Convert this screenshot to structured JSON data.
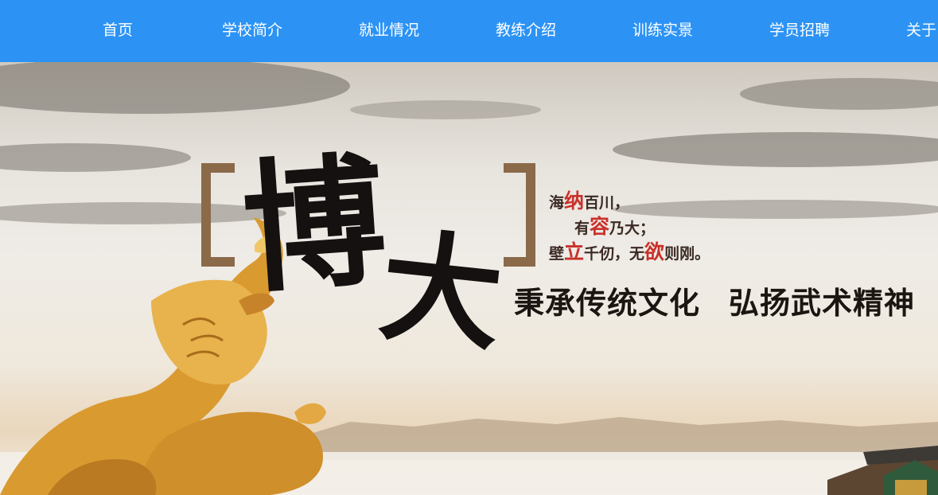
{
  "nav": {
    "items": [
      {
        "label": "首页"
      },
      {
        "label": "学校简介"
      },
      {
        "label": "就业情况"
      },
      {
        "label": "教练介绍"
      },
      {
        "label": "训练实景"
      },
      {
        "label": "学员招聘"
      },
      {
        "label": "关于"
      }
    ]
  },
  "banner": {
    "calligraphy": [
      "博",
      "大"
    ],
    "poem": {
      "line1_pre": "海",
      "line1_accent": "纳",
      "line1_post": "百川，",
      "line2_pre": "有",
      "line2_accent": "容",
      "line2_post": "乃大；",
      "line3_pre": "壁",
      "line3_accent": "立",
      "line3_mid": "千仞，无",
      "line3_accent2": "欲",
      "line3_post": "则刚。"
    },
    "slogan_part1": "秉承传统文化",
    "slogan_part2": "弘扬武术精神"
  },
  "colors": {
    "nav_bg": "#2c93f5",
    "nav_text": "#ffffff",
    "accent_red": "#c9312b",
    "dragon_gold": "#e0a23a"
  }
}
